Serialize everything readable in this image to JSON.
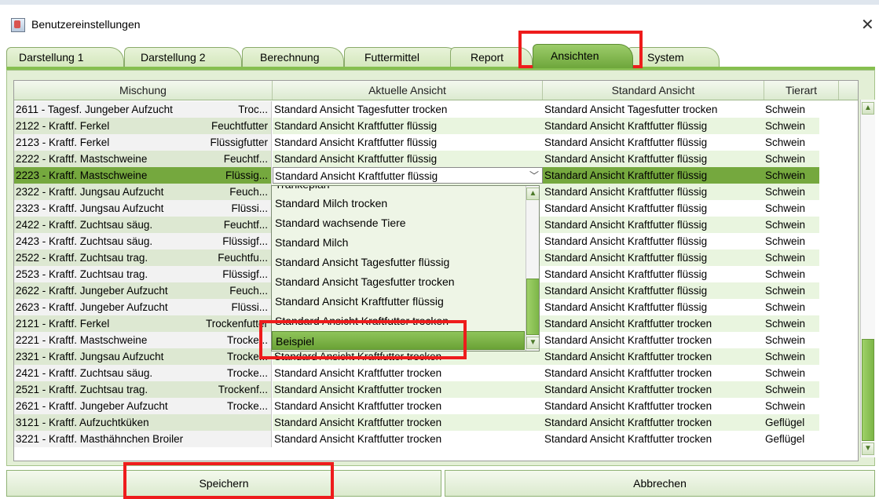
{
  "window": {
    "title": "Benutzereinstellungen",
    "close_symbol": "✕"
  },
  "tabs": [
    {
      "label": "Darstellung 1"
    },
    {
      "label": "Darstellung 2"
    },
    {
      "label": "Berechnung"
    },
    {
      "label": "Futtermittel"
    },
    {
      "label": "Report"
    },
    {
      "label": "Ansichten",
      "active": true
    },
    {
      "label": "System"
    }
  ],
  "table": {
    "headers": [
      "Mischung",
      "Aktuelle Ansicht",
      "Standard Ansicht",
      "Tierart"
    ],
    "rows": [
      {
        "mix": "2611 - Tagesf. Jungeber Aufzucht",
        "form": "Troc...",
        "current": "Standard Ansicht Tagesfutter trocken",
        "standard": "Standard Ansicht Tagesfutter trocken",
        "species": "Schwein"
      },
      {
        "mix": "2122 - Kraftf. Ferkel",
        "form": "Feuchtfutter",
        "current": "Standard Ansicht Kraftfutter flüssig",
        "standard": "Standard Ansicht Kraftfutter flüssig",
        "species": "Schwein"
      },
      {
        "mix": "2123 - Kraftf. Ferkel",
        "form": "Flüssigfutter",
        "current": "Standard Ansicht Kraftfutter flüssig",
        "standard": "Standard Ansicht Kraftfutter flüssig",
        "species": "Schwein"
      },
      {
        "mix": "2222 - Kraftf. Mastschweine",
        "form": "Feuchtf...",
        "current": "Standard Ansicht Kraftfutter flüssig",
        "standard": "Standard Ansicht Kraftfutter flüssig",
        "species": "Schwein"
      },
      {
        "mix": "2223 - Kraftf. Mastschweine",
        "form": "Flüssig...",
        "current": "Standard Ansicht Kraftfutter flüssig",
        "standard": "Standard Ansicht Kraftfutter flüssig",
        "species": "Schwein",
        "selected": true
      },
      {
        "mix": "2322 - Kraftf. Jungsau Aufzucht",
        "form": "Feuch...",
        "current": "",
        "standard": "Standard Ansicht Kraftfutter flüssig",
        "species": "Schwein"
      },
      {
        "mix": "2323 - Kraftf. Jungsau Aufzucht",
        "form": "Flüssi...",
        "current": "",
        "standard": "Standard Ansicht Kraftfutter flüssig",
        "species": "Schwein"
      },
      {
        "mix": "2422 - Kraftf. Zuchtsau säug.",
        "form": "Feuchtf...",
        "current": "",
        "standard": "Standard Ansicht Kraftfutter flüssig",
        "species": "Schwein"
      },
      {
        "mix": "2423 - Kraftf. Zuchtsau säug.",
        "form": "Flüssigf...",
        "current": "",
        "standard": "Standard Ansicht Kraftfutter flüssig",
        "species": "Schwein"
      },
      {
        "mix": "2522 - Kraftf. Zuchtsau trag.",
        "form": "Feuchtfu...",
        "current": "",
        "standard": "Standard Ansicht Kraftfutter flüssig",
        "species": "Schwein"
      },
      {
        "mix": "2523 - Kraftf. Zuchtsau trag.",
        "form": "Flüssigf...",
        "current": "",
        "standard": "Standard Ansicht Kraftfutter flüssig",
        "species": "Schwein"
      },
      {
        "mix": "2622 - Kraftf. Jungeber Aufzucht",
        "form": "Feuch...",
        "current": "",
        "standard": "Standard Ansicht Kraftfutter flüssig",
        "species": "Schwein"
      },
      {
        "mix": "2623 - Kraftf. Jungeber Aufzucht",
        "form": "Flüssi...",
        "current": "",
        "standard": "Standard Ansicht Kraftfutter flüssig",
        "species": "Schwein"
      },
      {
        "mix": "2121 - Kraftf. Ferkel",
        "form": "Trockenfutter",
        "current": "",
        "standard": "Standard Ansicht Kraftfutter trocken",
        "species": "Schwein"
      },
      {
        "mix": "2221 - Kraftf. Mastschweine",
        "form": "Trocke...",
        "current": "",
        "standard": "Standard Ansicht Kraftfutter trocken",
        "species": "Schwein"
      },
      {
        "mix": "2321 - Kraftf. Jungsau Aufzucht",
        "form": "Trocke...",
        "current": "Standard Ansicht Kraftfutter trocken",
        "standard": "Standard Ansicht Kraftfutter trocken",
        "species": "Schwein"
      },
      {
        "mix": "2421 - Kraftf. Zuchtsau säug.",
        "form": "Trocke...",
        "current": "Standard Ansicht Kraftfutter trocken",
        "standard": "Standard Ansicht Kraftfutter trocken",
        "species": "Schwein"
      },
      {
        "mix": "2521 - Kraftf. Zuchtsau trag.",
        "form": "Trockenf...",
        "current": "Standard Ansicht Kraftfutter trocken",
        "standard": "Standard Ansicht Kraftfutter trocken",
        "species": "Schwein"
      },
      {
        "mix": "2621 - Kraftf. Jungeber Aufzucht",
        "form": "Trocke...",
        "current": "Standard Ansicht Kraftfutter trocken",
        "standard": "Standard Ansicht Kraftfutter trocken",
        "species": "Schwein"
      },
      {
        "mix": "3121 - Kraftf. Aufzuchtküken",
        "form": "",
        "current": "Standard Ansicht Kraftfutter trocken",
        "standard": "Standard Ansicht Kraftfutter trocken",
        "species": "Geflügel"
      },
      {
        "mix": "3221 - Kraftf. Masthähnchen Broiler",
        "form": "",
        "current": "Standard Ansicht Kraftfutter trocken",
        "standard": "Standard Ansicht Kraftfutter trocken",
        "species": "Geflügel"
      }
    ]
  },
  "dropdown": {
    "partial_top": "Tränkeplan",
    "items": [
      "Standard Milch trocken",
      "Standard wachsende Tiere",
      "Standard Milch",
      "Standard Ansicht Tagesfutter flüssig",
      "Standard Ansicht Tagesfutter trocken",
      "Standard Ansicht Kraftfutter flüssig",
      "Standard Ansicht Kraftfutter trocken",
      "Beispiel"
    ],
    "selected": "Beispiel"
  },
  "buttons": {
    "save": "Speichern",
    "cancel": "Abbrechen"
  },
  "colors": {
    "highlight_box": "#ee1c1c",
    "accent_green": "#75a83e"
  }
}
